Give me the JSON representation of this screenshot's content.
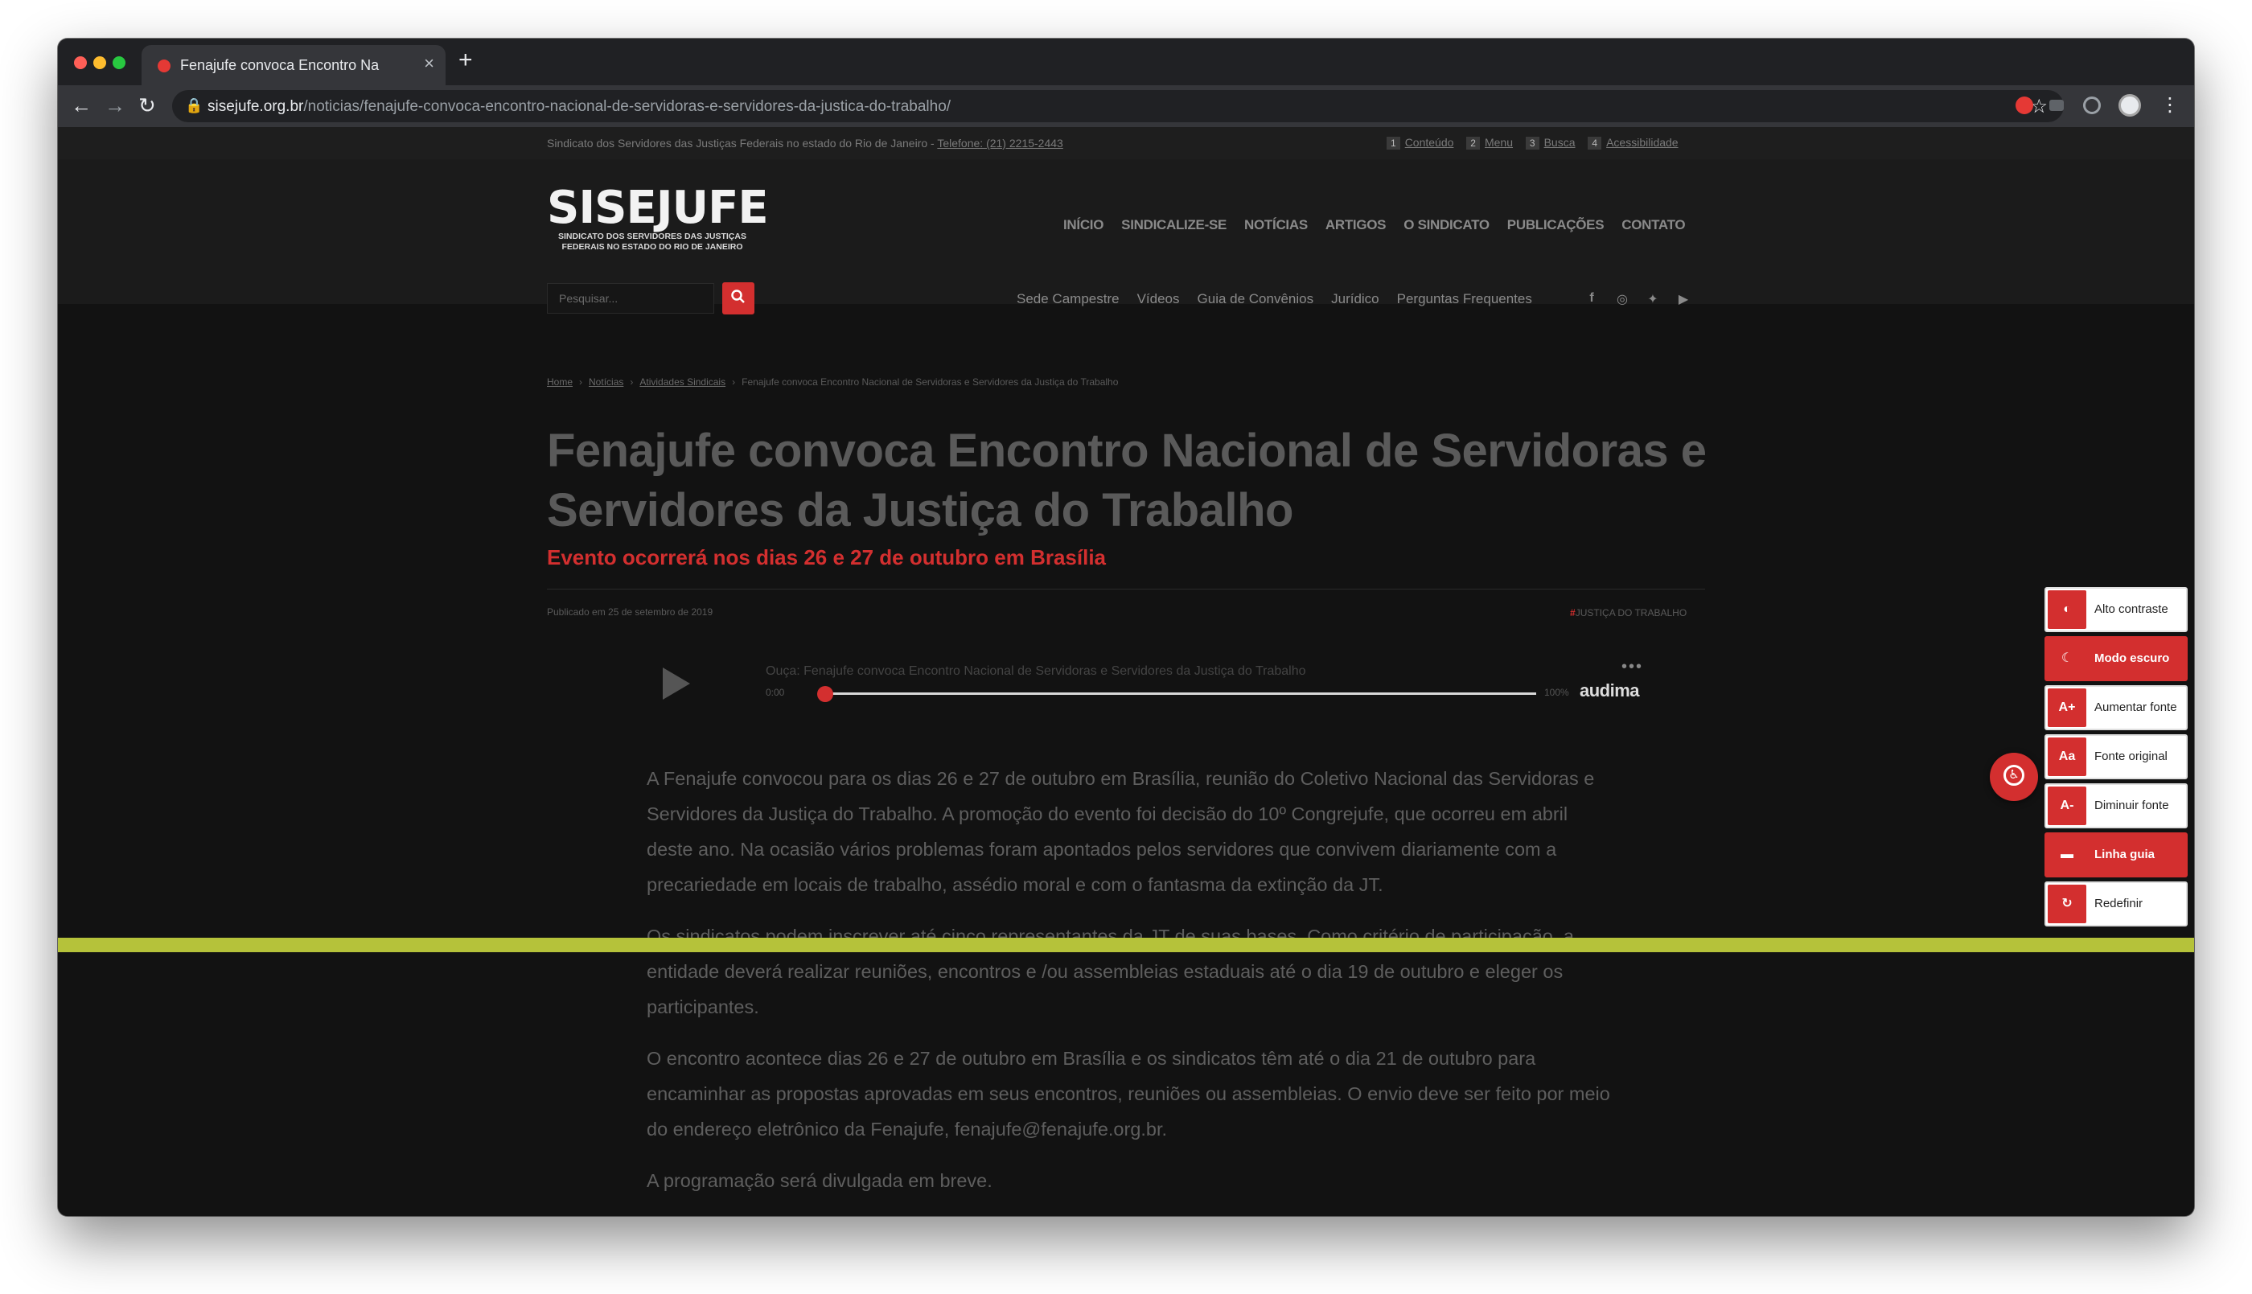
{
  "browser": {
    "tab_title": "Fenajufe convoca Encontro Na",
    "tab_close": "×",
    "new_tab": "+",
    "url_host": "sisejufe.org.br",
    "url_path": "/noticias/fenajufe-convoca-encontro-nacional-de-servidoras-e-servidores-da-justica-do-trabalho/",
    "back": "←",
    "forward": "→",
    "reload": "↻",
    "lock": "🔒",
    "star": "☆",
    "menu": "⋮"
  },
  "topbar": {
    "text": "Sindicato dos Servidores das Justiças Federais no estado do Rio de Janeiro - ",
    "phone": "Telefone: (21) 2215-2443",
    "skip_links": [
      {
        "num": "1",
        "label": "Conteúdo"
      },
      {
        "num": "2",
        "label": "Menu"
      },
      {
        "num": "3",
        "label": "Busca"
      },
      {
        "num": "4",
        "label": "Acessibilidade"
      }
    ]
  },
  "logo": {
    "main": "SISEJUFE",
    "sub_line1": "SINDICATO DOS SERVIDORES DAS JUSTIÇAS",
    "sub_line2": "FEDERAIS NO ESTADO DO RIO DE JANEIRO"
  },
  "main_nav": [
    "INÍCIO",
    "SINDICALIZE-SE",
    "NOTÍCIAS",
    "ARTIGOS",
    "O SINDICATO",
    "PUBLICAÇÕES",
    "CONTATO"
  ],
  "search": {
    "placeholder": "Pesquisar...",
    "icon": "search-icon"
  },
  "sub_nav": [
    "Sede Campestre",
    "Vídeos",
    "Guia de Convênios",
    "Jurídico",
    "Perguntas Frequentes"
  ],
  "social": [
    "facebook-icon",
    "instagram-icon",
    "twitter-icon",
    "youtube-icon"
  ],
  "breadcrumb": {
    "home": "Home",
    "noticias": "Notícias",
    "category": "Atividades Sindicais",
    "current": "Fenajufe convoca Encontro Nacional de Servidoras e Servidores da Justiça do Trabalho"
  },
  "article": {
    "title": "Fenajufe convoca Encontro Nacional de Servidoras e Servidores da Justiça do Trabalho",
    "subtitle": "Evento ocorrerá nos dias 26 e 27 de outubro em Brasília",
    "published": "Publicado em 25 de setembro de 2019",
    "tag_hash": "#",
    "tag": "JUSTIÇA DO TRABALHO",
    "paragraphs": [
      "A Fenajufe convocou para os dias 26 e 27 de outubro em Brasília, reunião do Coletivo Nacional das Servidoras e Servidores da Justiça do Trabalho. A promoção do evento foi decisão do 10º Congrejufe, que ocorreu em abril deste ano. Na ocasião vários problemas foram apontados pelos servidores que convivem diariamente com a precariedade em locais de trabalho, assédio moral e com o fantasma da extinção da JT.",
      "Os sindicatos podem inscrever até cinco representantes da JT de suas bases.  Como critério de participação, a entidade deverá realizar reuniões, encontros e /ou assembleias estaduais até o dia 19 de outubro e eleger os participantes.",
      "O encontro acontece dias 26 e 27 de outubro em Brasília e os sindicatos têm até o dia 21 de outubro para encaminhar as propostas aprovadas em seus encontros, reuniões ou assembleias. O envio deve ser feito por meio do endereço eletrônico da Fenajufe, fenajufe@fenajufe.org.br.",
      "A programação será divulgada em breve."
    ]
  },
  "player": {
    "title": "Ouça: Fenajufe convoca Encontro Nacional de Servidoras e Servidores da Justiça do Trabalho",
    "time": "0:00",
    "volume": "100%",
    "brand": "audima",
    "more": "•••",
    "progress": 0
  },
  "accessibility": {
    "fab_icon": "accessibility-icon",
    "items": [
      {
        "icon": "◐",
        "label": "Alto contraste",
        "active": false
      },
      {
        "icon": "☾",
        "label": "Modo escuro",
        "active": true
      },
      {
        "icon": "A+",
        "label": "Aumentar fonte",
        "active": false
      },
      {
        "icon": "Aa",
        "label": "Fonte original",
        "active": false
      },
      {
        "icon": "A-",
        "label": "Diminuir fonte",
        "active": false
      },
      {
        "icon": "▬",
        "label": "Linha guia",
        "active": true
      },
      {
        "icon": "↻",
        "label": "Redefinir",
        "active": false
      }
    ]
  },
  "colors": {
    "accent": "#d32f2f",
    "reading_guide": "#b5c23a",
    "page_bg": "#121212"
  }
}
